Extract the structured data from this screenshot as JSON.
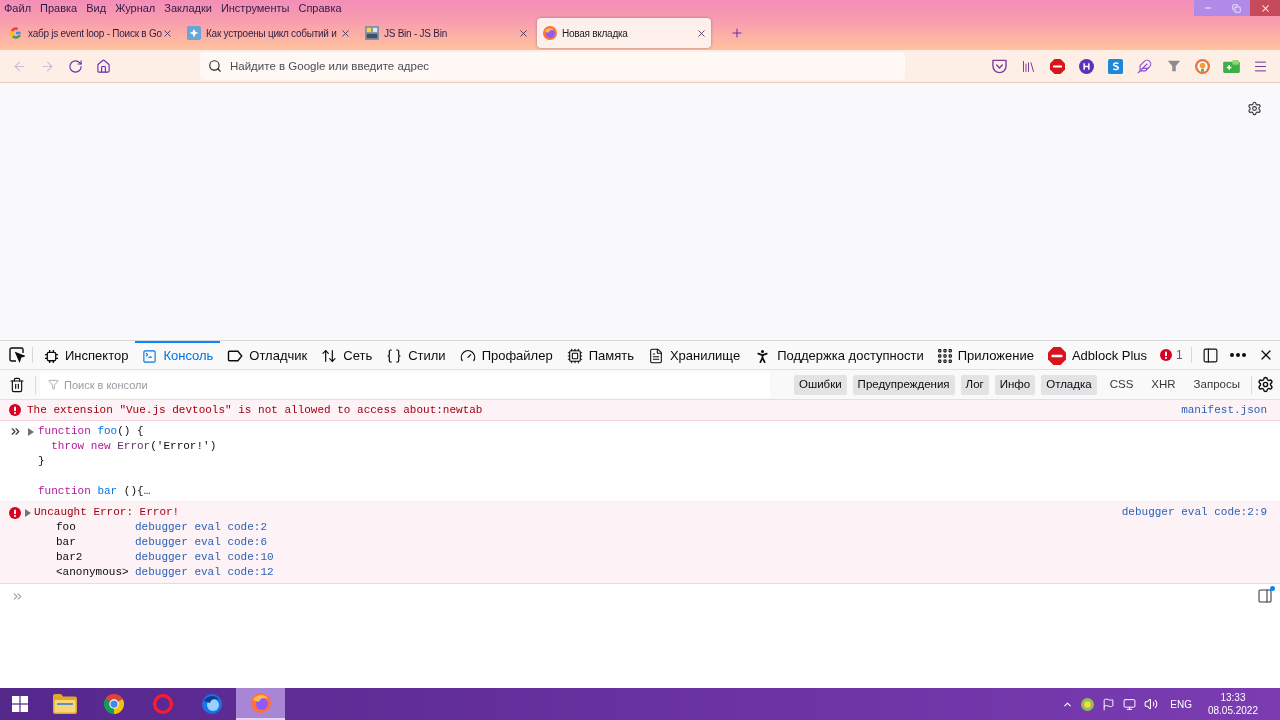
{
  "menu_bar": [
    "Файл",
    "Правка",
    "Вид",
    "Журнал",
    "Закладки",
    "Инструменты",
    "Справка"
  ],
  "tabs": [
    {
      "kind": "search",
      "title": "хабр js event loop - Поиск в Go",
      "selected": false
    },
    {
      "kind": "article",
      "title": "Как устроены цикл событий и",
      "selected": false
    },
    {
      "kind": "jsbin",
      "title": "JS Bin - JS Bin",
      "selected": false
    },
    {
      "kind": "newtab",
      "title": "Новая вкладка",
      "selected": true
    }
  ],
  "navigation": [
    {
      "kind": "back",
      "disabled": true
    },
    {
      "kind": "forward",
      "disabled": true
    },
    {
      "kind": "reload",
      "disabled": false
    },
    {
      "kind": "home",
      "disabled": false
    }
  ],
  "address_bar": {
    "placeholder": "Найдите в Google или введите адрес"
  },
  "devtools": {
    "tabs": [
      {
        "kind": "inspector",
        "label": "Инспектор",
        "selected": false
      },
      {
        "kind": "console",
        "label": "Консоль",
        "selected": true
      },
      {
        "kind": "debugger",
        "label": "Отладчик",
        "selected": false
      },
      {
        "kind": "network",
        "label": "Сеть",
        "selected": false
      },
      {
        "kind": "style",
        "label": "Стили",
        "selected": false
      },
      {
        "kind": "profiler",
        "label": "Профайлер",
        "selected": false
      },
      {
        "kind": "memory",
        "label": "Память",
        "selected": false
      },
      {
        "kind": "storage",
        "label": "Хранилище",
        "selected": false
      },
      {
        "kind": "accessibility",
        "label": "Поддержка доступности",
        "selected": false
      },
      {
        "kind": "application",
        "label": "Приложение",
        "selected": false
      },
      {
        "kind": "adblock",
        "label": "Adblock Plus",
        "selected": false
      }
    ],
    "error_count": "1",
    "filter": {
      "placeholder": "Поиск в консоли"
    },
    "filter_buttons": [
      {
        "label": "Ошибки",
        "selected": true
      },
      {
        "label": "Предупреждения",
        "selected": true
      },
      {
        "label": "Лог",
        "selected": true
      },
      {
        "label": "Инфо",
        "selected": true
      },
      {
        "label": "Отладка",
        "selected": true
      },
      {
        "label": "CSS",
        "selected": false
      },
      {
        "label": "XHR",
        "selected": false
      },
      {
        "label": "Запросы",
        "selected": false
      }
    ],
    "messages": [
      {
        "kind": "error",
        "text": "The extension \"Vue.js devtools\" is not allowed to access about:newtab",
        "source": "manifest.json"
      },
      {
        "kind": "input",
        "expanded": false,
        "blocks": [
          {
            "lines": [
              {
                "tokens": [
                  {
                    "kind": "keyword",
                    "text": "function "
                  },
                  {
                    "kind": "name",
                    "text": "foo"
                  },
                  {
                    "kind": "plain",
                    "text": "() {"
                  }
                ]
              },
              {
                "tokens": [
                  {
                    "kind": "keyword",
                    "text": "  throw new "
                  },
                  {
                    "kind": "builtin",
                    "text": "Error"
                  },
                  {
                    "kind": "plain",
                    "text": "('Error!')"
                  }
                ]
              },
              {
                "tokens": [
                  {
                    "kind": "plain",
                    "text": "}"
                  }
                ]
              }
            ]
          },
          {
            "lines": [
              {
                "tokens": [
                  {
                    "kind": "keyword",
                    "text": "function "
                  },
                  {
                    "kind": "name",
                    "text": "bar"
                  },
                  {
                    "kind": "plain",
                    "text": " (){…"
                  }
                ]
              }
            ]
          }
        ]
      },
      {
        "kind": "exception",
        "expanded": false,
        "text": "Uncaught Error: Error!",
        "source": "debugger eval code:2:9",
        "frames": [
          {
            "function": "foo",
            "location": "debugger eval code:2"
          },
          {
            "function": "bar",
            "location": "debugger eval code:6"
          },
          {
            "function": "bar2",
            "location": "debugger eval code:10"
          },
          {
            "function": "<anonymous>",
            "location": "debugger eval code:12"
          }
        ]
      }
    ]
  },
  "taskbar": {
    "apps": [
      {
        "kind": "start",
        "selected": false
      },
      {
        "kind": "explorer",
        "selected": false
      },
      {
        "kind": "chrome",
        "selected": false
      },
      {
        "kind": "opera",
        "selected": false
      },
      {
        "kind": "firefox_dev",
        "selected": false
      },
      {
        "kind": "firefox",
        "selected": true
      }
    ],
    "language": "ENG",
    "time": "13:33",
    "date": "08.05.2022"
  }
}
